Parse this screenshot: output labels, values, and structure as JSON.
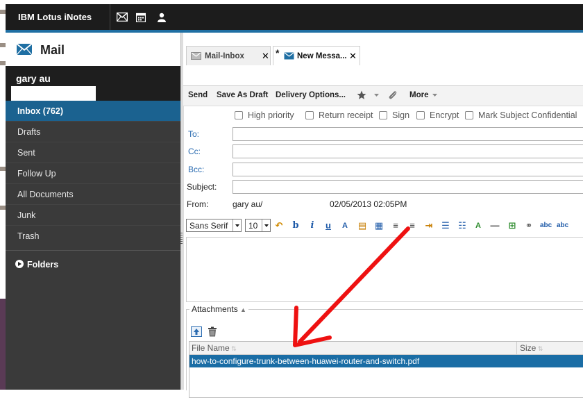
{
  "app": {
    "title": "IBM Lotus iNotes"
  },
  "header": {
    "section_title": "Mail"
  },
  "top_icons": [
    "envelope-icon",
    "calendar-icon",
    "contacts-icon"
  ],
  "sidebar": {
    "user_name": "gary au",
    "items": [
      {
        "label": "Inbox (762)"
      },
      {
        "label": "Drafts"
      },
      {
        "label": "Sent"
      },
      {
        "label": "Follow Up"
      },
      {
        "label": "All Documents"
      },
      {
        "label": "Junk"
      },
      {
        "label": "Trash"
      }
    ],
    "folders_label": "Folders"
  },
  "tabs": [
    {
      "label": "Mail-Inbox",
      "close": "✕"
    },
    {
      "label": "New Messa...",
      "close": "✕",
      "modified": "*"
    }
  ],
  "toolbar": {
    "send": "Send",
    "save_draft": "Save As Draft",
    "delivery": "Delivery Options...",
    "more": "More"
  },
  "options": [
    {
      "label": "High priority"
    },
    {
      "label": "Return receipt"
    },
    {
      "label": "Sign"
    },
    {
      "label": "Encrypt"
    },
    {
      "label": "Mark Subject Confidential"
    }
  ],
  "fields": {
    "to_label": "To:",
    "cc_label": "Cc:",
    "bcc_label": "Bcc:",
    "subject_label": "Subject:",
    "from_label": "From:",
    "from_value": "gary au/",
    "date_value": "02/05/2013 02:05PM"
  },
  "editor": {
    "font": "Sans Serif",
    "size": "10"
  },
  "attachments": {
    "legend": "Attachments",
    "col_file": "File Name",
    "col_size": "Size",
    "files": [
      {
        "name": "how-to-configure-trunk-between-huawei-router-and-switch.pdf"
      }
    ]
  },
  "colors": {
    "accent": "#1f6fa3",
    "selection": "#1a6da5",
    "arrow": "#ee1111"
  }
}
